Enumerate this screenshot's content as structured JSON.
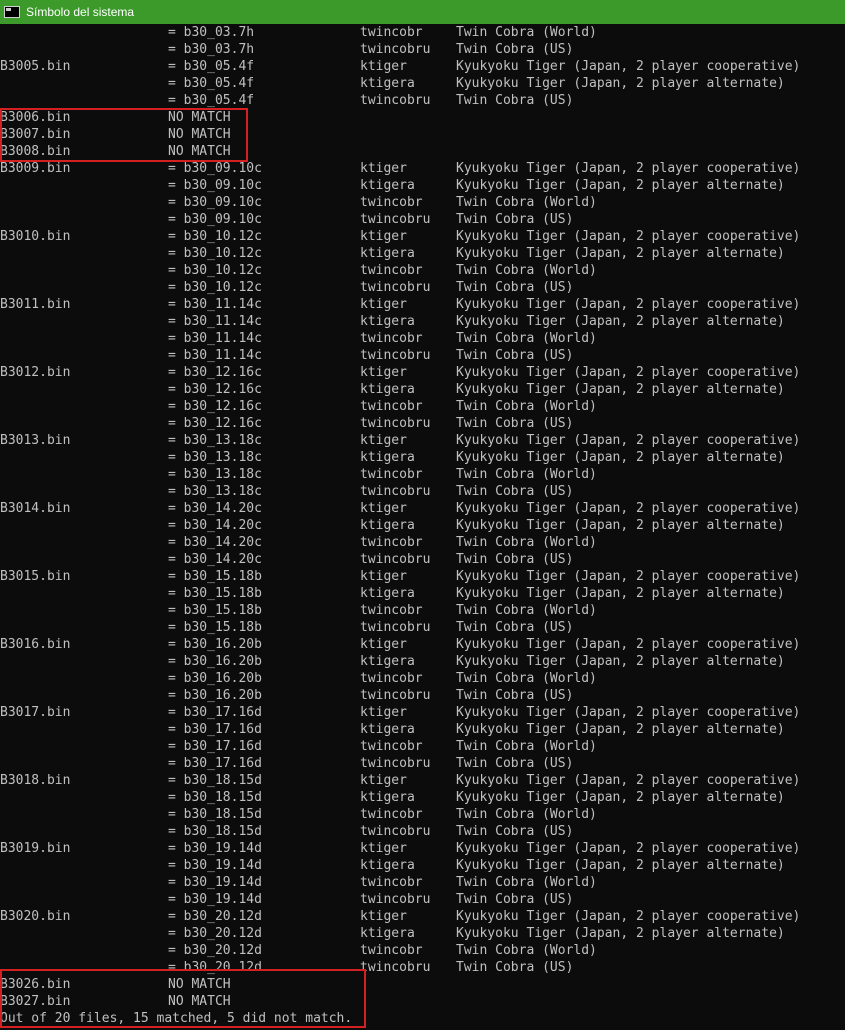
{
  "window": {
    "title": "Símbolo del sistema",
    "icon": "cmd-icon"
  },
  "console": {
    "lines": [
      {
        "file": "",
        "match": "= b30_03.7h",
        "set": "twincobr",
        "desc": "Twin Cobra (World)"
      },
      {
        "file": "",
        "match": "= b30_03.7h",
        "set": "twincobru",
        "desc": "Twin Cobra (US)"
      },
      {
        "file": "B3005.bin",
        "match": "= b30_05.4f",
        "set": "ktiger",
        "desc": "Kyukyoku Tiger (Japan, 2 player cooperative)"
      },
      {
        "file": "",
        "match": "= b30_05.4f",
        "set": "ktigera",
        "desc": "Kyukyoku Tiger (Japan, 2 player alternate)"
      },
      {
        "file": "",
        "match": "= b30_05.4f",
        "set": "twincobru",
        "desc": "Twin Cobra (US)"
      },
      {
        "file": "B3006.bin",
        "match": "NO MATCH",
        "set": "",
        "desc": ""
      },
      {
        "file": "B3007.bin",
        "match": "NO MATCH",
        "set": "",
        "desc": ""
      },
      {
        "file": "B3008.bin",
        "match": "NO MATCH",
        "set": "",
        "desc": ""
      },
      {
        "file": "B3009.bin",
        "match": "= b30_09.10c",
        "set": "ktiger",
        "desc": "Kyukyoku Tiger (Japan, 2 player cooperative)"
      },
      {
        "file": "",
        "match": "= b30_09.10c",
        "set": "ktigera",
        "desc": "Kyukyoku Tiger (Japan, 2 player alternate)"
      },
      {
        "file": "",
        "match": "= b30_09.10c",
        "set": "twincobr",
        "desc": "Twin Cobra (World)"
      },
      {
        "file": "",
        "match": "= b30_09.10c",
        "set": "twincobru",
        "desc": "Twin Cobra (US)"
      },
      {
        "file": "B3010.bin",
        "match": "= b30_10.12c",
        "set": "ktiger",
        "desc": "Kyukyoku Tiger (Japan, 2 player cooperative)"
      },
      {
        "file": "",
        "match": "= b30_10.12c",
        "set": "ktigera",
        "desc": "Kyukyoku Tiger (Japan, 2 player alternate)"
      },
      {
        "file": "",
        "match": "= b30_10.12c",
        "set": "twincobr",
        "desc": "Twin Cobra (World)"
      },
      {
        "file": "",
        "match": "= b30_10.12c",
        "set": "twincobru",
        "desc": "Twin Cobra (US)"
      },
      {
        "file": "B3011.bin",
        "match": "= b30_11.14c",
        "set": "ktiger",
        "desc": "Kyukyoku Tiger (Japan, 2 player cooperative)"
      },
      {
        "file": "",
        "match": "= b30_11.14c",
        "set": "ktigera",
        "desc": "Kyukyoku Tiger (Japan, 2 player alternate)"
      },
      {
        "file": "",
        "match": "= b30_11.14c",
        "set": "twincobr",
        "desc": "Twin Cobra (World)"
      },
      {
        "file": "",
        "match": "= b30_11.14c",
        "set": "twincobru",
        "desc": "Twin Cobra (US)"
      },
      {
        "file": "B3012.bin",
        "match": "= b30_12.16c",
        "set": "ktiger",
        "desc": "Kyukyoku Tiger (Japan, 2 player cooperative)"
      },
      {
        "file": "",
        "match": "= b30_12.16c",
        "set": "ktigera",
        "desc": "Kyukyoku Tiger (Japan, 2 player alternate)"
      },
      {
        "file": "",
        "match": "= b30_12.16c",
        "set": "twincobr",
        "desc": "Twin Cobra (World)"
      },
      {
        "file": "",
        "match": "= b30_12.16c",
        "set": "twincobru",
        "desc": "Twin Cobra (US)"
      },
      {
        "file": "B3013.bin",
        "match": "= b30_13.18c",
        "set": "ktiger",
        "desc": "Kyukyoku Tiger (Japan, 2 player cooperative)"
      },
      {
        "file": "",
        "match": "= b30_13.18c",
        "set": "ktigera",
        "desc": "Kyukyoku Tiger (Japan, 2 player alternate)"
      },
      {
        "file": "",
        "match": "= b30_13.18c",
        "set": "twincobr",
        "desc": "Twin Cobra (World)"
      },
      {
        "file": "",
        "match": "= b30_13.18c",
        "set": "twincobru",
        "desc": "Twin Cobra (US)"
      },
      {
        "file": "B3014.bin",
        "match": "= b30_14.20c",
        "set": "ktiger",
        "desc": "Kyukyoku Tiger (Japan, 2 player cooperative)"
      },
      {
        "file": "",
        "match": "= b30_14.20c",
        "set": "ktigera",
        "desc": "Kyukyoku Tiger (Japan, 2 player alternate)"
      },
      {
        "file": "",
        "match": "= b30_14.20c",
        "set": "twincobr",
        "desc": "Twin Cobra (World)"
      },
      {
        "file": "",
        "match": "= b30_14.20c",
        "set": "twincobru",
        "desc": "Twin Cobra (US)"
      },
      {
        "file": "B3015.bin",
        "match": "= b30_15.18b",
        "set": "ktiger",
        "desc": "Kyukyoku Tiger (Japan, 2 player cooperative)"
      },
      {
        "file": "",
        "match": "= b30_15.18b",
        "set": "ktigera",
        "desc": "Kyukyoku Tiger (Japan, 2 player alternate)"
      },
      {
        "file": "",
        "match": "= b30_15.18b",
        "set": "twincobr",
        "desc": "Twin Cobra (World)"
      },
      {
        "file": "",
        "match": "= b30_15.18b",
        "set": "twincobru",
        "desc": "Twin Cobra (US)"
      },
      {
        "file": "B3016.bin",
        "match": "= b30_16.20b",
        "set": "ktiger",
        "desc": "Kyukyoku Tiger (Japan, 2 player cooperative)"
      },
      {
        "file": "",
        "match": "= b30_16.20b",
        "set": "ktigera",
        "desc": "Kyukyoku Tiger (Japan, 2 player alternate)"
      },
      {
        "file": "",
        "match": "= b30_16.20b",
        "set": "twincobr",
        "desc": "Twin Cobra (World)"
      },
      {
        "file": "",
        "match": "= b30_16.20b",
        "set": "twincobru",
        "desc": "Twin Cobra (US)"
      },
      {
        "file": "B3017.bin",
        "match": "= b30_17.16d",
        "set": "ktiger",
        "desc": "Kyukyoku Tiger (Japan, 2 player cooperative)"
      },
      {
        "file": "",
        "match": "= b30_17.16d",
        "set": "ktigera",
        "desc": "Kyukyoku Tiger (Japan, 2 player alternate)"
      },
      {
        "file": "",
        "match": "= b30_17.16d",
        "set": "twincobr",
        "desc": "Twin Cobra (World)"
      },
      {
        "file": "",
        "match": "= b30_17.16d",
        "set": "twincobru",
        "desc": "Twin Cobra (US)"
      },
      {
        "file": "B3018.bin",
        "match": "= b30_18.15d",
        "set": "ktiger",
        "desc": "Kyukyoku Tiger (Japan, 2 player cooperative)"
      },
      {
        "file": "",
        "match": "= b30_18.15d",
        "set": "ktigera",
        "desc": "Kyukyoku Tiger (Japan, 2 player alternate)"
      },
      {
        "file": "",
        "match": "= b30_18.15d",
        "set": "twincobr",
        "desc": "Twin Cobra (World)"
      },
      {
        "file": "",
        "match": "= b30_18.15d",
        "set": "twincobru",
        "desc": "Twin Cobra (US)"
      },
      {
        "file": "B3019.bin",
        "match": "= b30_19.14d",
        "set": "ktiger",
        "desc": "Kyukyoku Tiger (Japan, 2 player cooperative)"
      },
      {
        "file": "",
        "match": "= b30_19.14d",
        "set": "ktigera",
        "desc": "Kyukyoku Tiger (Japan, 2 player alternate)"
      },
      {
        "file": "",
        "match": "= b30_19.14d",
        "set": "twincobr",
        "desc": "Twin Cobra (World)"
      },
      {
        "file": "",
        "match": "= b30_19.14d",
        "set": "twincobru",
        "desc": "Twin Cobra (US)"
      },
      {
        "file": "B3020.bin",
        "match": "= b30_20.12d",
        "set": "ktiger",
        "desc": "Kyukyoku Tiger (Japan, 2 player cooperative)"
      },
      {
        "file": "",
        "match": "= b30_20.12d",
        "set": "ktigera",
        "desc": "Kyukyoku Tiger (Japan, 2 player alternate)"
      },
      {
        "file": "",
        "match": "= b30_20.12d",
        "set": "twincobr",
        "desc": "Twin Cobra (World)"
      },
      {
        "file": "",
        "match": "= b30_20.12d",
        "set": "twincobru",
        "desc": "Twin Cobra (US)"
      },
      {
        "file": "B3026.bin",
        "match": "NO MATCH",
        "set": "",
        "desc": ""
      },
      {
        "file": "B3027.bin",
        "match": "NO MATCH",
        "set": "",
        "desc": ""
      }
    ],
    "summary": "Out of 20 files, 15 matched, 5 did not match."
  },
  "colors": {
    "titlebar_bg": "#3c9a2a",
    "console_bg": "#0c0c0c",
    "console_text": "#c0c0c0",
    "highlight_border": "#d42020"
  }
}
